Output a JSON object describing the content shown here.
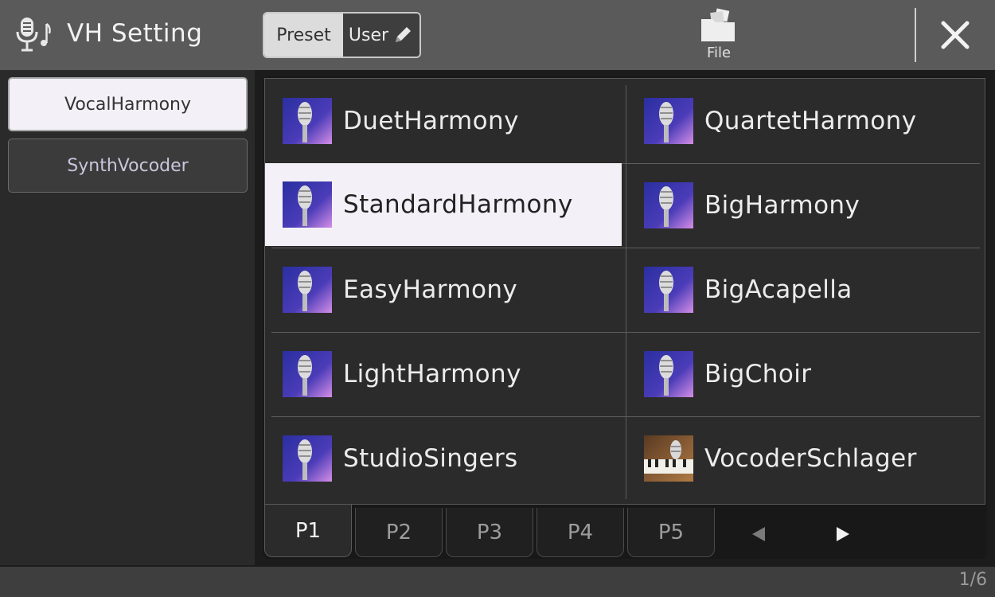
{
  "header": {
    "title": "VH Setting",
    "icon": "vocal-harmony-mic-icon",
    "preset_label": "Preset",
    "user_label": "User",
    "file_label": "File",
    "close_icon": "close-icon"
  },
  "categories": [
    {
      "label": "VocalHarmony",
      "selected": true
    },
    {
      "label": "SynthVocoder",
      "selected": false
    }
  ],
  "presets": {
    "left": [
      "DuetHarmony",
      "StandardHarmony",
      "EasyHarmony",
      "LightHarmony",
      "StudioSingers"
    ],
    "right": [
      "QuartetHarmony",
      "BigHarmony",
      "BigAcapella",
      "BigChoir",
      "VocoderSchlager"
    ],
    "selected": "StandardHarmony",
    "thumb_icons": [
      "microphone-thumbnail-icon",
      "piano-microphone-thumbnail-icon"
    ]
  },
  "pages": {
    "tabs": [
      "P1",
      "P2",
      "P3",
      "P4",
      "P5"
    ],
    "active": "P1",
    "prev_icon": "arrow-left-icon",
    "next_icon": "arrow-right-icon"
  },
  "footer": {
    "page_indicator": "1/6"
  },
  "colors": {
    "header_bg": "#5a5a5a",
    "selected_bg": "#f3f1f7",
    "thumb_blue": "#3f3aa8",
    "thumb_purple": "#c87fe0"
  }
}
